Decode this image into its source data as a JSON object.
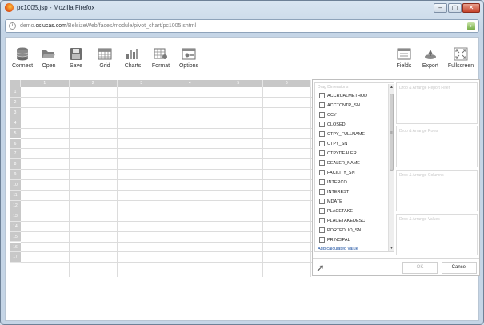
{
  "window": {
    "title": "pc1005.jsp - Mozilla Firefox",
    "minimize": "–",
    "restore": "▢",
    "close": "✕"
  },
  "urlbar": {
    "info": "i",
    "prefix": "demo.",
    "domain": "cslucas.com",
    "path": "/BelsizeWeb/faces/module/pivot_chart/pc1005.shtml",
    "go": "▸"
  },
  "toolbar": {
    "connect": "Connect",
    "open": "Open",
    "save": "Save",
    "grid": "Grid",
    "charts": "Charts",
    "format": "Format",
    "options": "Options",
    "fields": "Fields",
    "export": "Export",
    "fullscreen": "Fullscreen"
  },
  "grid": {
    "columns": [
      "1",
      "2",
      "3",
      "4",
      "5",
      "6"
    ],
    "rows": [
      "1",
      "2",
      "3",
      "4",
      "5",
      "6",
      "7",
      "8",
      "9",
      "10",
      "11",
      "12",
      "13",
      "14",
      "15",
      "16",
      "17"
    ]
  },
  "dialog": {
    "list_title": "Drag Dimensions",
    "fields": [
      "ACCRUALMETHOD",
      "ACCTCNTR_SN",
      "CCY",
      "CLOSED",
      "CTPY_FULLNAME",
      "CTPY_SN",
      "CTPYDEALER",
      "DEALER_NAME",
      "FACILITY_SN",
      "INTERCO",
      "INTEREST",
      "MDATE",
      "PLACETAKE",
      "PLACETAKEDESC",
      "PORTFOLIO_SN",
      "PRINCIPAL"
    ],
    "add_calculated": "Add calculated value",
    "zones": {
      "report_filter": "Drop & Arrange Report Filter",
      "rows": "Drop & Arrange Rows",
      "columns": "Drop & Arrange Columns",
      "values": "Drop & Arrange Values"
    },
    "ok": "OK",
    "cancel": "Cancel",
    "scroll_up": "▲",
    "scroll_down": "▼",
    "grip": "≡",
    "arrow": "➚"
  }
}
